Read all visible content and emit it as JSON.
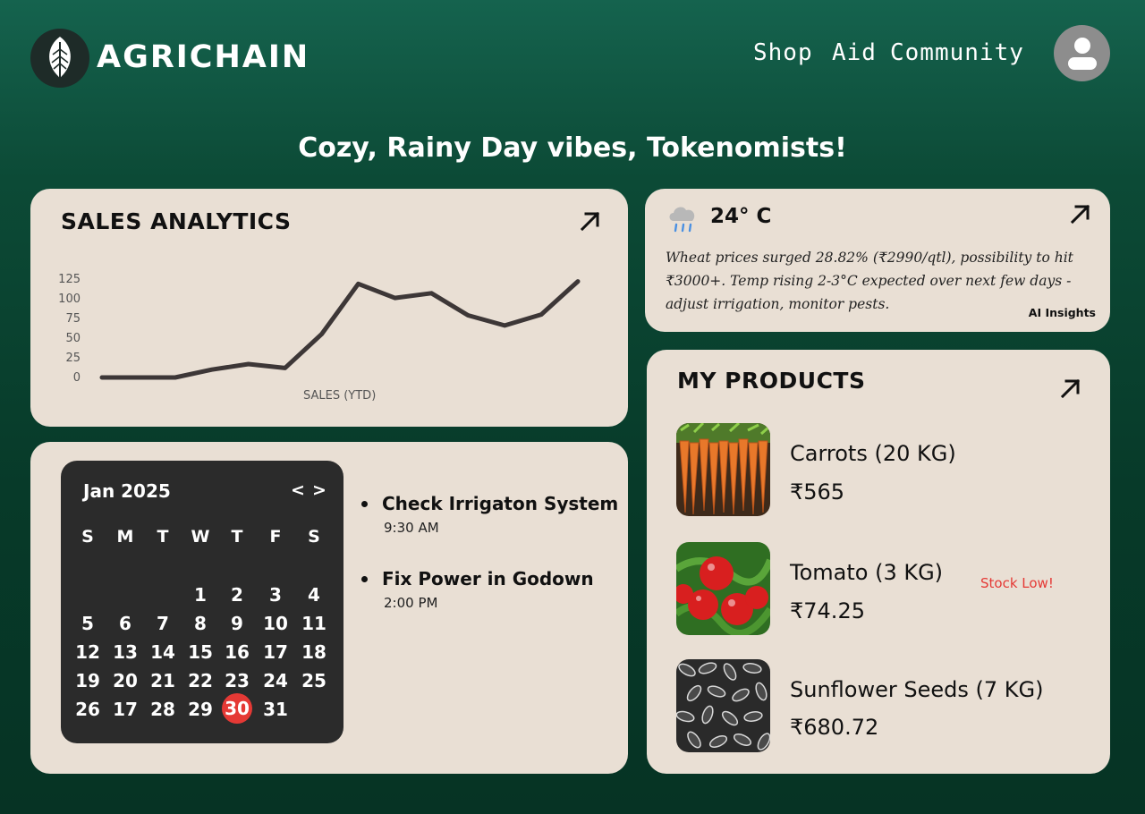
{
  "brand": {
    "name": "AGRICHAIN",
    "logo_icon": "leaf-icon"
  },
  "nav": {
    "items": [
      "Shop",
      "Aid",
      "Community"
    ],
    "avatar_icon": "user-icon"
  },
  "greeting": "Cozy, Rainy Day vibes, Tokenomists!",
  "sales": {
    "title": "SALES ANALYTICS",
    "expand_icon": "arrow-up-right-icon",
    "chart_data": {
      "type": "line",
      "xlabel": "SALES (YTD)",
      "ylabel": "",
      "yticks": [
        0,
        25,
        50,
        75,
        100,
        125
      ],
      "ylim": [
        0,
        125
      ],
      "x": [
        0,
        1,
        2,
        3,
        4,
        5,
        6,
        7,
        8,
        9,
        10,
        11,
        12,
        13
      ],
      "values": [
        0,
        0,
        0,
        10,
        17,
        12,
        55,
        119,
        101,
        107,
        79,
        66,
        80,
        122
      ],
      "grid": false,
      "color": "#3d3737"
    }
  },
  "weather": {
    "icon": "rain-cloud-icon",
    "temperature": "24° C",
    "insight": "Wheat prices surged 28.82% (₹2990/qtl), possibility to hit ₹3000+. Temp rising 2-3°C expected over next few days - adjust irrigation, monitor pests.",
    "tag": "AI Insights",
    "expand_icon": "arrow-up-right-icon"
  },
  "products": {
    "title": "MY PRODUCTS",
    "expand_icon": "arrow-up-right-icon",
    "items": [
      {
        "name": "Carrots (20 KG)",
        "price": "₹565",
        "image": "carrots-image"
      },
      {
        "name": "Tomato (3 KG)",
        "price": "₹74.25",
        "image": "tomato-image",
        "status": "Stock Low!"
      },
      {
        "name": "Sunflower Seeds (7 KG)",
        "price": "₹680.72",
        "image": "sunflower-seeds-image"
      }
    ],
    "status_color": "#e53935"
  },
  "calendar": {
    "month": "Jan 2025",
    "prev": "<",
    "next": ">",
    "weekdays": [
      "S",
      "M",
      "T",
      "W",
      "T",
      "F",
      "S"
    ],
    "weeks": [
      [
        "",
        "",
        "",
        "1",
        "2",
        "3",
        "4"
      ],
      [
        "5",
        "6",
        "7",
        "8",
        "9",
        "10",
        "11"
      ],
      [
        "12",
        "13",
        "14",
        "15",
        "16",
        "17",
        "18"
      ],
      [
        "19",
        "20",
        "21",
        "22",
        "23",
        "24",
        "25"
      ],
      [
        "26",
        "17",
        "28",
        "29",
        "30",
        "31",
        ""
      ]
    ],
    "today": "30",
    "today_color": "#e53935"
  },
  "tasks": [
    {
      "title": "Check Irrigaton System",
      "time": "9:30 AM"
    },
    {
      "title": "Fix Power in Godown",
      "time": "2:00 PM"
    }
  ]
}
